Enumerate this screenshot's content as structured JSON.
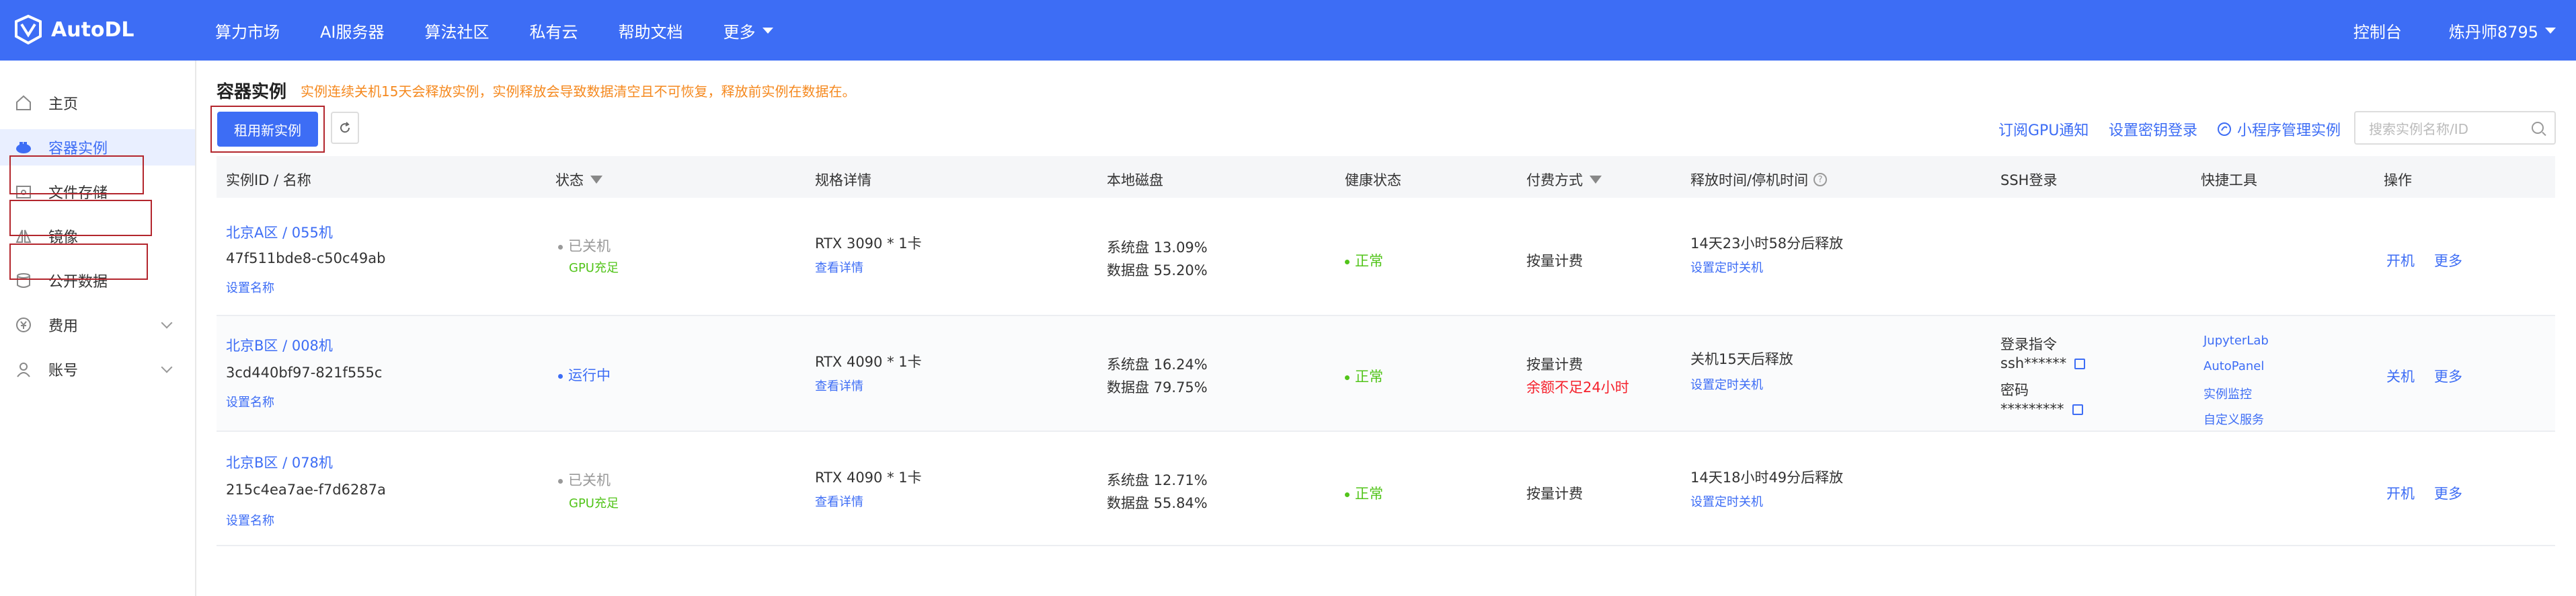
{
  "brand": {
    "name": "AutoDL"
  },
  "nav": {
    "items": [
      "算力市场",
      "AI服务器",
      "算法社区",
      "私有云",
      "帮助文档"
    ],
    "more": "更多"
  },
  "top_right": {
    "console": "控制台",
    "user": "炼丹师8795"
  },
  "sidebar": {
    "items": [
      {
        "label": "主页",
        "icon": "home-icon"
      },
      {
        "label": "容器实例",
        "icon": "container-icon"
      },
      {
        "label": "文件存储",
        "icon": "folder-icon"
      },
      {
        "label": "镜像",
        "icon": "image-icon"
      },
      {
        "label": "公开数据",
        "icon": "database-icon"
      },
      {
        "label": "费用",
        "icon": "yen-icon"
      },
      {
        "label": "账号",
        "icon": "user-icon"
      }
    ]
  },
  "page": {
    "title": "容器实例",
    "warning": "实例连续关机15天会释放实例，实例释放会导致数据清空且不可恢复，释放前实例在数据在。",
    "new_button": "租用新实例",
    "links": {
      "gpu_notify": "订阅GPU通知",
      "ssh_key": "设置密钥登录",
      "mini_program": "小程序管理实例"
    },
    "search_placeholder": "搜索实例名称/ID"
  },
  "table": {
    "headers": {
      "id": "实例ID / 名称",
      "status": "状态",
      "spec": "规格详情",
      "disk": "本地磁盘",
      "health": "健康状态",
      "pay": "付费方式",
      "release": "释放时间/停机时间",
      "ssh": "SSH登录",
      "tools": "快捷工具",
      "ops": "操作"
    },
    "rows": [
      {
        "region": "北京A区 / 055机",
        "id": "47f511bde8-c50c49ab",
        "set_name": "设置名称",
        "status": "已关机",
        "status_sub": "GPU充足",
        "spec": "RTX 3090 * 1卡",
        "spec_link": "查看详情",
        "disk_sys": "系统盘 13.09%",
        "disk_data": "数据盘 55.20%",
        "health": "正常",
        "pay": "按量计费",
        "pay_sub": "",
        "release": "14天23小时58分后释放",
        "release_link": "设置定时关机",
        "op1": "开机",
        "op2": "更多"
      },
      {
        "region": "北京B区 / 008机",
        "id": "3cd440bf97-821f555c",
        "set_name": "设置名称",
        "status": "运行中",
        "status_sub": "",
        "spec": "RTX 4090 * 1卡",
        "spec_link": "查看详情",
        "disk_sys": "系统盘 16.24%",
        "disk_data": "数据盘 79.75%",
        "health": "正常",
        "pay": "按量计费",
        "pay_sub": "余额不足24小时",
        "release": "关机15天后释放",
        "release_link": "设置定时关机",
        "ssh_cmd_label": "登录指令",
        "ssh_cmd": "ssh******",
        "ssh_pwd_label": "密码",
        "ssh_pwd": "*********",
        "tools": [
          "JupyterLab",
          "AutoPanel",
          "实例监控",
          "自定义服务"
        ],
        "op1": "关机",
        "op2": "更多"
      },
      {
        "region": "北京B区 / 078机",
        "id": "215c4ea7ae-f7d6287a",
        "set_name": "设置名称",
        "status": "已关机",
        "status_sub": "GPU充足",
        "spec": "RTX 4090 * 1卡",
        "spec_link": "查看详情",
        "disk_sys": "系统盘 12.71%",
        "disk_data": "数据盘 55.84%",
        "health": "正常",
        "pay": "按量计费",
        "pay_sub": "",
        "release": "14天18小时49分后释放",
        "release_link": "设置定时关机",
        "op1": "开机",
        "op2": "更多"
      }
    ]
  },
  "colors": {
    "primary": "#3d6df5",
    "warning": "#f5891f",
    "success": "#52c41a",
    "danger": "#f5222d",
    "highlight_box": "#b3262d"
  }
}
